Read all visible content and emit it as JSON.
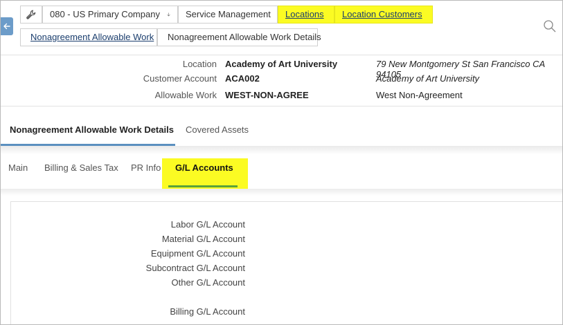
{
  "breadcrumbs": {
    "row1": [
      {
        "label": "080 - US Primary Company",
        "icon": "arrow-down-icon"
      },
      {
        "label": "Service Management"
      },
      {
        "label": "Locations"
      },
      {
        "label": "Location Customers"
      }
    ],
    "row2": [
      {
        "label": "Nonagreement Allowable Work"
      },
      {
        "label": "Nonagreement Allowable Work Details"
      }
    ]
  },
  "summary": {
    "location_label": "Location",
    "location_value": "Academy of Art University",
    "location_address": "79 New Montgomery St San Francisco CA 94105",
    "customer_label": "Customer Account",
    "customer_value": "ACA002",
    "customer_name": "Academy of Art University",
    "work_label": "Allowable Work",
    "work_value": "WEST-NON-AGREE",
    "work_description": "West Non-Agreement"
  },
  "primary_tabs": [
    {
      "label": "Nonagreement Allowable Work Details",
      "active": true
    },
    {
      "label": "Covered Assets",
      "active": false
    }
  ],
  "secondary_tabs": [
    {
      "label": "Main",
      "active": false
    },
    {
      "label": "Billing & Sales Tax",
      "active": false
    },
    {
      "label": "PR Info",
      "active": false
    },
    {
      "label": "G/L Accounts",
      "active": true
    }
  ],
  "gl_accounts": {
    "labor": "Labor G/L Account",
    "material": "Material G/L Account",
    "equipment": "Equipment G/L Account",
    "subcontract": "Subcontract G/L Account",
    "other": "Other G/L Account",
    "billing": "Billing G/L Account"
  },
  "colors": {
    "highlight": "#fbfb23",
    "link": "#1a3d6d",
    "back_button": "#6c9cc9",
    "tab_underline_blue": "#5b8fbf",
    "tab_underline_green": "#5aa23a"
  }
}
